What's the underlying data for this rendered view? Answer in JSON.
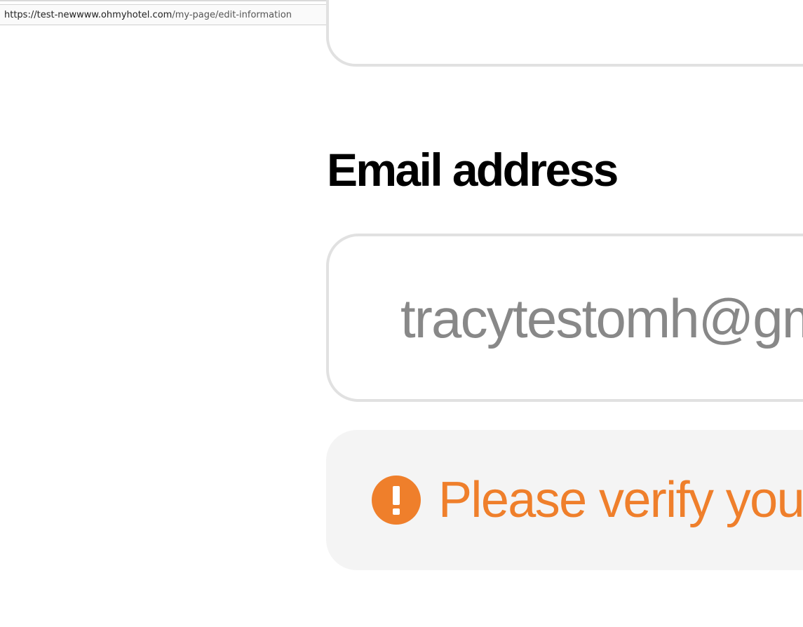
{
  "browser": {
    "url_host": "https://test-newwww.ohmyhotel.com",
    "url_path": "/my-page/edit-information"
  },
  "email_section": {
    "title": "Email address",
    "email_value": "tracytestomh@gmail.com"
  },
  "verification_notice": {
    "icon": "exclamation-circle-icon",
    "text": "Please verify your email address",
    "color": "#ef7f2b"
  }
}
